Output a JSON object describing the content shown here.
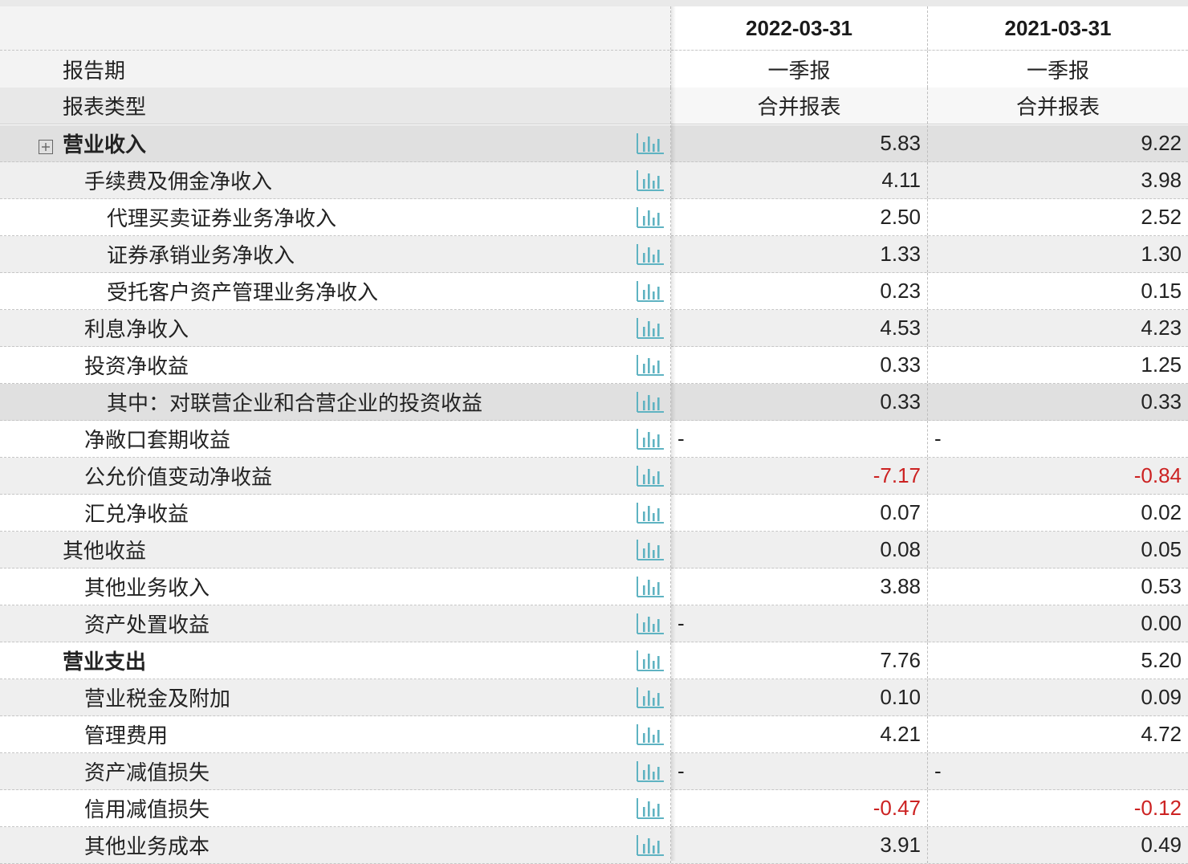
{
  "header": {
    "period1": "2022-03-31",
    "period2": "2021-03-31"
  },
  "meta": [
    {
      "label": "报告期",
      "v1": "一季报",
      "v2": "一季报"
    },
    {
      "label": "报表类型",
      "v1": "合并报表",
      "v2": "合并报表"
    }
  ],
  "icons": {
    "chart": "bar-chart-icon",
    "expand": "plus-square-icon",
    "negative_color": "#cc2222"
  },
  "rows": [
    {
      "label": "营业收入",
      "v1": "5.83",
      "v2": "9.22"
    },
    {
      "label": "手续费及佣金净收入",
      "v1": "4.11",
      "v2": "3.98"
    },
    {
      "label": "代理买卖证券业务净收入",
      "v1": "2.50",
      "v2": "2.52"
    },
    {
      "label": "证券承销业务净收入",
      "v1": "1.33",
      "v2": "1.30"
    },
    {
      "label": "受托客户资产管理业务净收入",
      "v1": "0.23",
      "v2": "0.15"
    },
    {
      "label": "利息净收入",
      "v1": "4.53",
      "v2": "4.23"
    },
    {
      "label": "投资净收益",
      "v1": "0.33",
      "v2": "1.25"
    },
    {
      "label": "其中：对联营企业和合营企业的投资收益",
      "v1": "0.33",
      "v2": "0.33"
    },
    {
      "label": "净敞口套期收益",
      "v1": "-",
      "v2": "-"
    },
    {
      "label": "公允价值变动净收益",
      "v1": "-7.17",
      "v2": "-0.84"
    },
    {
      "label": "汇兑净收益",
      "v1": "0.07",
      "v2": "0.02"
    },
    {
      "label": "其他收益",
      "v1": "0.08",
      "v2": "0.05"
    },
    {
      "label": "其他业务收入",
      "v1": "3.88",
      "v2": "0.53"
    },
    {
      "label": "资产处置收益",
      "v1": "-",
      "v2": "0.00"
    },
    {
      "label": "营业支出",
      "v1": "7.76",
      "v2": "5.20"
    },
    {
      "label": "营业税金及附加",
      "v1": "0.10",
      "v2": "0.09"
    },
    {
      "label": "管理费用",
      "v1": "4.21",
      "v2": "4.72"
    },
    {
      "label": "资产减值损失",
      "v1": "-",
      "v2": "-"
    },
    {
      "label": "信用减值损失",
      "v1": "-0.47",
      "v2": "-0.12"
    },
    {
      "label": "其他业务成本",
      "v1": "3.91",
      "v2": "0.49"
    }
  ]
}
